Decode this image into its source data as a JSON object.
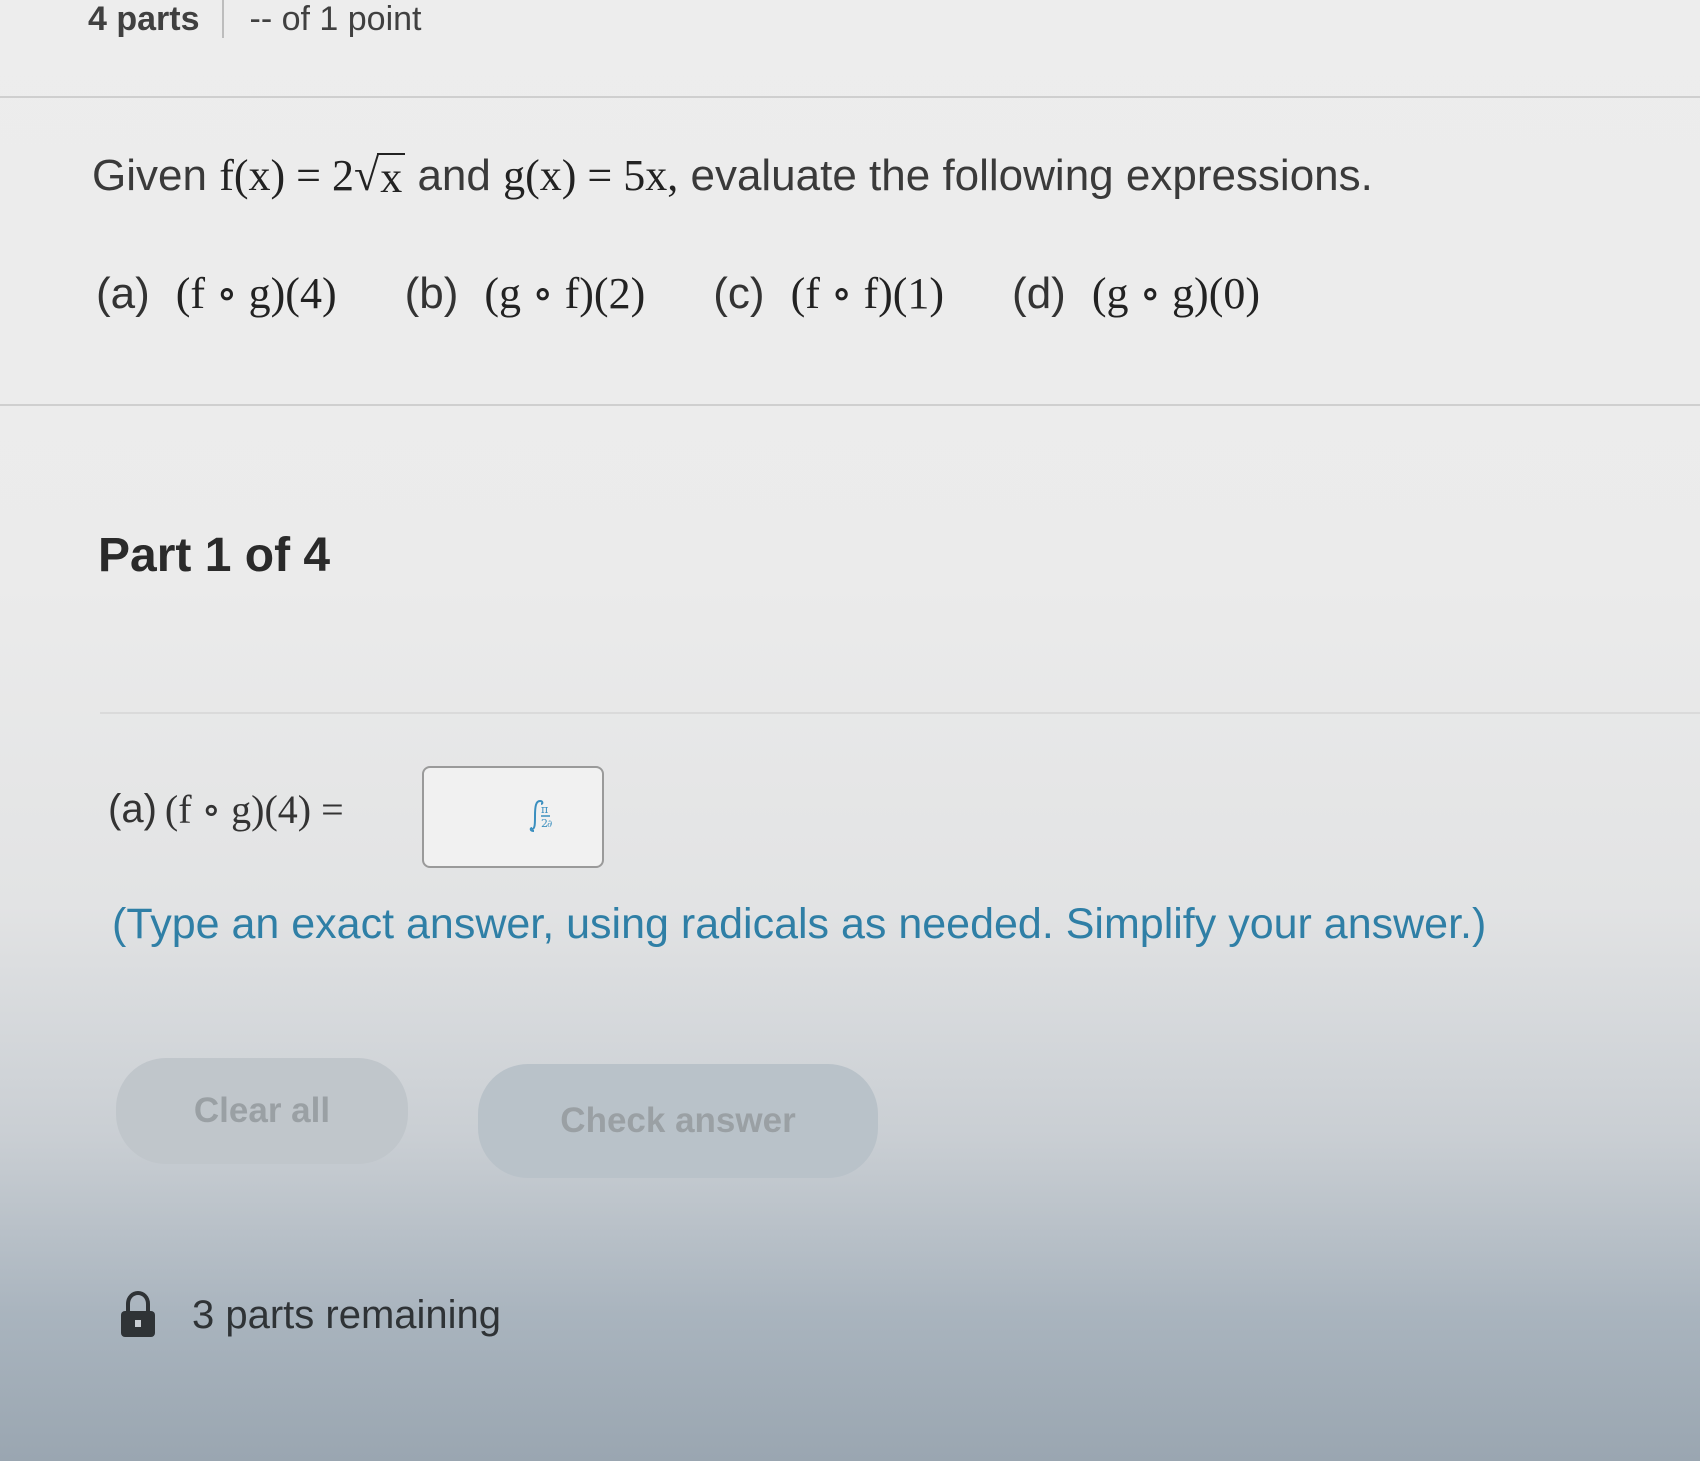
{
  "header": {
    "parts": "4 parts",
    "points": "-- of 1 point"
  },
  "question": {
    "given_prefix": "Given",
    "f_lhs": "f(x) = 2",
    "f_radicand": "x",
    "connector": "and",
    "g_expr": "g(x) = 5x,",
    "instruction": "evaluate the following expressions."
  },
  "parts": [
    {
      "label": "(a)",
      "expr": "(f ∘ g)(4)"
    },
    {
      "label": "(b)",
      "expr": "(g ∘ f)(2)"
    },
    {
      "label": "(c)",
      "expr": "(f ∘ f)(1)"
    },
    {
      "label": "(d)",
      "expr": "(g ∘ g)(0)"
    }
  ],
  "part_title": "Part 1 of 4",
  "answer": {
    "label": "(a)",
    "expr": "(f ∘ g)(4) =",
    "value": "",
    "mathtool_icon": "integral-pi-icon"
  },
  "instructions": "(Type an exact answer, using radicals as needed. Simplify your answer.)",
  "buttons": {
    "clear_all": "Clear all",
    "check_answer": "Check answer"
  },
  "status": {
    "icon": "lock-icon",
    "remaining": "3 parts remaining"
  }
}
